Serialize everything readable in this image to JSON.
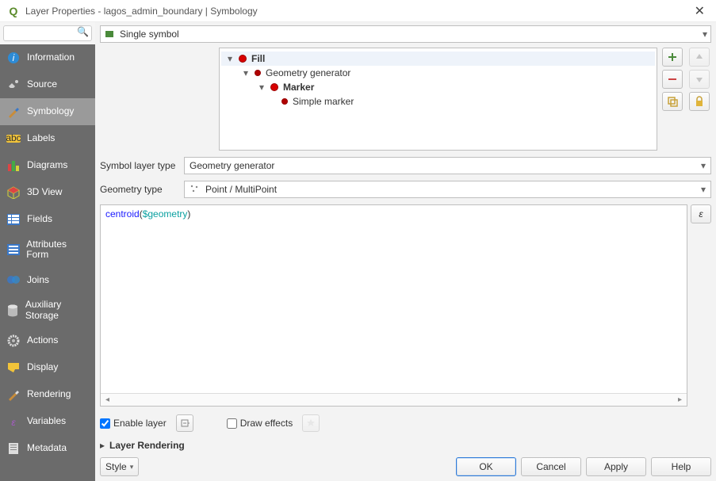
{
  "window": {
    "title": "Layer Properties - lagos_admin_boundary | Symbology"
  },
  "sidebar": {
    "search_placeholder": "",
    "items": [
      {
        "label": "Information"
      },
      {
        "label": "Source"
      },
      {
        "label": "Symbology"
      },
      {
        "label": "Labels"
      },
      {
        "label": "Diagrams"
      },
      {
        "label": "3D View"
      },
      {
        "label": "Fields"
      },
      {
        "label": "Attributes Form"
      },
      {
        "label": "Joins"
      },
      {
        "label": "Auxiliary Storage"
      },
      {
        "label": "Actions"
      },
      {
        "label": "Display"
      },
      {
        "label": "Rendering"
      },
      {
        "label": "Variables"
      },
      {
        "label": "Metadata"
      }
    ],
    "selected_index": 2
  },
  "top_dropdown": {
    "value": "Single symbol"
  },
  "tree": {
    "nodes": [
      {
        "label": "Fill",
        "level": 0,
        "bold": true,
        "selected": true
      },
      {
        "label": "Geometry generator",
        "level": 1,
        "bold": false
      },
      {
        "label": "Marker",
        "level": 2,
        "bold": true
      },
      {
        "label": "Simple marker",
        "level": 3,
        "bold": false
      }
    ]
  },
  "side_buttons": {
    "add": "add",
    "up": "up",
    "remove": "remove",
    "down": "down",
    "duplicate": "duplicate",
    "lock": "lock"
  },
  "form": {
    "symbol_layer_type_label": "Symbol layer type",
    "symbol_layer_type_value": "Geometry generator",
    "geometry_type_label": "Geometry type",
    "geometry_type_value": "Point / MultiPoint"
  },
  "expression": {
    "fn": "centroid",
    "open": "(",
    "var": "$geometry",
    "close": ")"
  },
  "epsilon_label": "ε",
  "controls": {
    "enable_layer_label": "Enable layer",
    "enable_layer_checked": true,
    "draw_effects_label": "Draw effects",
    "draw_effects_checked": false
  },
  "collapsible": {
    "layer_rendering": "Layer Rendering"
  },
  "footer": {
    "style": "Style",
    "ok": "OK",
    "cancel": "Cancel",
    "apply": "Apply",
    "help": "Help"
  }
}
